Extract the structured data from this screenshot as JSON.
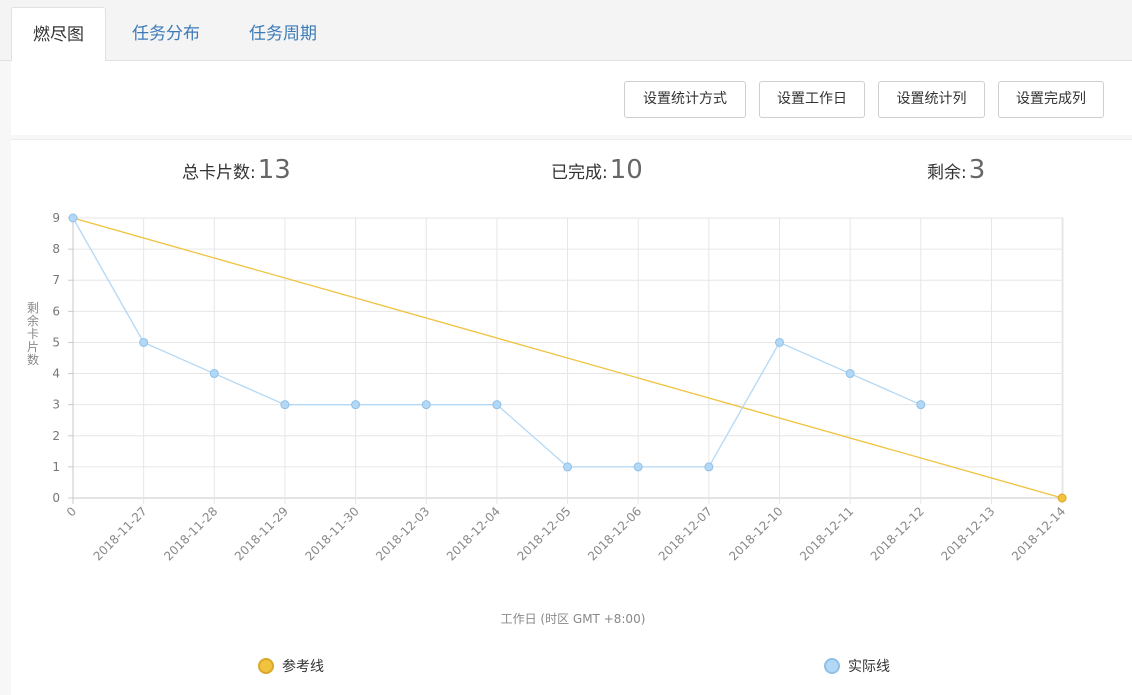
{
  "tabs": [
    {
      "label": "燃尽图",
      "active": true
    },
    {
      "label": "任务分布",
      "active": false
    },
    {
      "label": "任务周期",
      "active": false
    }
  ],
  "toolbar": {
    "buttons": [
      "设置统计方式",
      "设置工作日",
      "设置统计列",
      "设置完成列"
    ]
  },
  "stats": {
    "total_label": "总卡片数:",
    "total_value": "13",
    "done_label": "已完成:",
    "done_value": "10",
    "remaining_label": "剩余:",
    "remaining_value": "3"
  },
  "colors": {
    "reference": "#f0c23e",
    "actual": "#b3d8f5",
    "link": "#3d7bb8"
  },
  "legend": {
    "reference": "参考线",
    "actual": "实际线"
  },
  "chart_data": {
    "type": "line",
    "categories": [
      "0",
      "2018-11-27",
      "2018-11-28",
      "2018-11-29",
      "2018-11-30",
      "2018-12-03",
      "2018-12-04",
      "2018-12-05",
      "2018-12-06",
      "2018-12-07",
      "2018-12-10",
      "2018-12-11",
      "2018-12-12",
      "2018-12-13",
      "2018-12-14"
    ],
    "series": [
      {
        "name": "参考线",
        "color": "#f0c23e",
        "values": [
          9,
          null,
          null,
          null,
          null,
          null,
          null,
          null,
          null,
          null,
          null,
          null,
          null,
          null,
          0
        ]
      },
      {
        "name": "实际线",
        "color": "#b3d8f5",
        "values": [
          9,
          5,
          4,
          3,
          3,
          3,
          3,
          1,
          1,
          1,
          5,
          4,
          3,
          null,
          null
        ]
      }
    ],
    "yticks": [
      "0",
      "1",
      "2",
      "3",
      "4",
      "5",
      "6",
      "7",
      "8",
      "9"
    ],
    "ylim": [
      0,
      9
    ],
    "ylabel": "剩余卡片数",
    "xlabel": "工作日 (时区 GMT +8:00)",
    "grid": true,
    "legend_position": "bottom"
  }
}
